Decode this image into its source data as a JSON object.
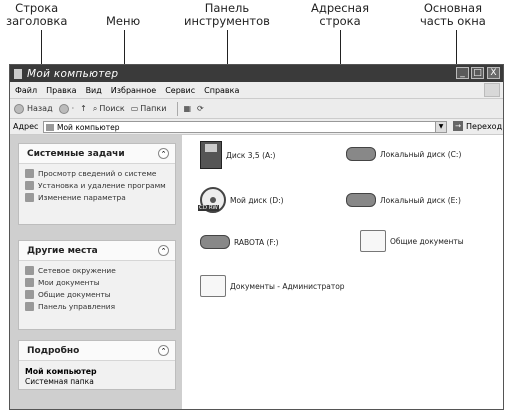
{
  "callouts": {
    "title_bar": [
      "Строка",
      "заголовка"
    ],
    "menu": [
      "Меню"
    ],
    "toolbar": [
      "Панель",
      "инструментов"
    ],
    "address_bar": [
      "Адресная",
      "строка"
    ],
    "main_area": [
      "Основная",
      "часть окна"
    ]
  },
  "window": {
    "title": "Мой компьютер",
    "buttons": {
      "minimize": "_",
      "maximize": "□",
      "close": "X"
    }
  },
  "menu": {
    "items": [
      "Файл",
      "Правка",
      "Вид",
      "Избранное",
      "Сервис",
      "Справка"
    ]
  },
  "toolbar": {
    "back": "Назад",
    "forward": "·",
    "up": "↑",
    "search": "Поиск",
    "folders": "Папки",
    "views": "▦",
    "sync": "⟳"
  },
  "address": {
    "label": "Адрес",
    "value": "Мой компьютер",
    "go": "Переход"
  },
  "sidebar": {
    "system_tasks": {
      "title": "Системные задачи",
      "items": [
        "Просмотр сведений о системе",
        "Установка и удаление программ",
        "Изменение параметра"
      ]
    },
    "other_places": {
      "title": "Другие места",
      "items": [
        "Сетевое окружение",
        "Мои документы",
        "Общие документы",
        "Панель управления"
      ]
    },
    "details": {
      "title": "Подробно",
      "name": "Мой компьютер",
      "type": "Системная папка"
    },
    "chevron": "⌃"
  },
  "drives": [
    {
      "label": "Диск 3,5 (A:)"
    },
    {
      "label": "Локальный диск (C:)"
    },
    {
      "label": "Мой диск (D:)",
      "badge": "CD RW"
    },
    {
      "label": "Локальный диск (E:)"
    },
    {
      "label": "RABOTA (F:)"
    },
    {
      "label": "Общие документы"
    },
    {
      "label": "Документы - Администратор"
    }
  ]
}
